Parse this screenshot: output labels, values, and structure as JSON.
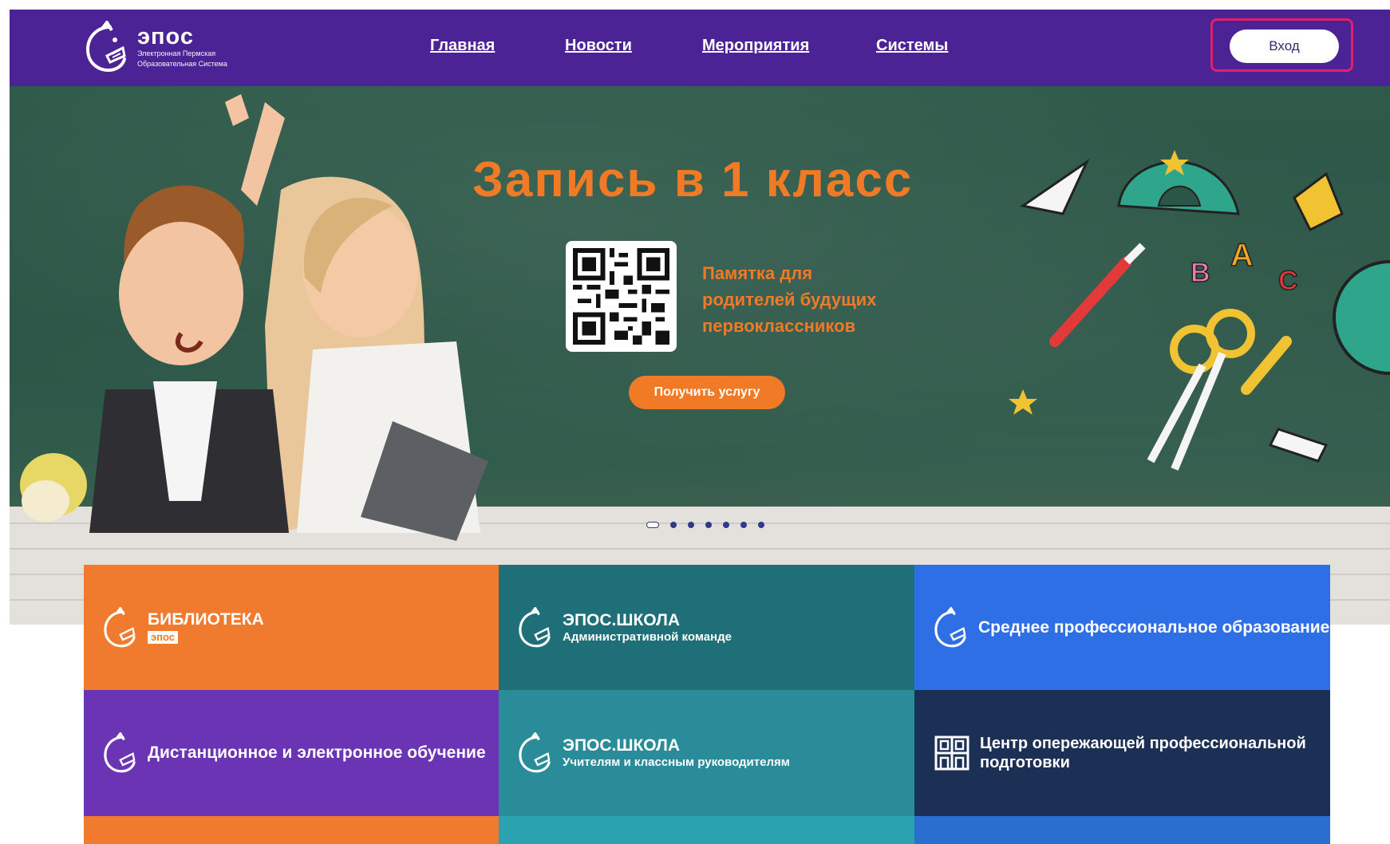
{
  "header": {
    "logo_name": "эпос",
    "logo_sub_line1": "Электронная Пермская",
    "logo_sub_line2": "Образовательная Система",
    "nav": [
      "Главная",
      "Новости",
      "Мероприятия",
      "Системы"
    ],
    "login_label": "Вход"
  },
  "hero": {
    "title": "Запись в 1 класс",
    "memo_line1": "Памятка для",
    "memo_line2": "родителей будущих",
    "memo_line3": "первоклассников",
    "button_label": "Получить услугу",
    "slides_count": 7,
    "active_slide": 1
  },
  "tiles": [
    {
      "title": "БИБЛИОТЕКА",
      "badge": "эпос",
      "color": "#f07a2e"
    },
    {
      "title": "ЭПОС.ШКОЛА",
      "subtitle": "Административной команде",
      "color": "#1f6f78"
    },
    {
      "title": "Среднее профессиональное образование",
      "color": "#2f6fe6"
    },
    {
      "title": "Дистанционное и электронное обучение",
      "color": "#6a34b4"
    },
    {
      "title": "ЭПОС.ШКОЛА",
      "subtitle": "Учителям и классным руководителям",
      "color": "#2a8c98"
    },
    {
      "title_line1": "Центр опережающей профессиональной",
      "title_line2": "подготовки",
      "color": "#1c2f55"
    }
  ],
  "colors": {
    "header_bg": "#4b2394",
    "accent_orange": "#f07a26",
    "login_highlight": "#e0206c"
  },
  "icons": [
    "epos-logo-icon",
    "qr-code-icon",
    "center-building-icon"
  ]
}
